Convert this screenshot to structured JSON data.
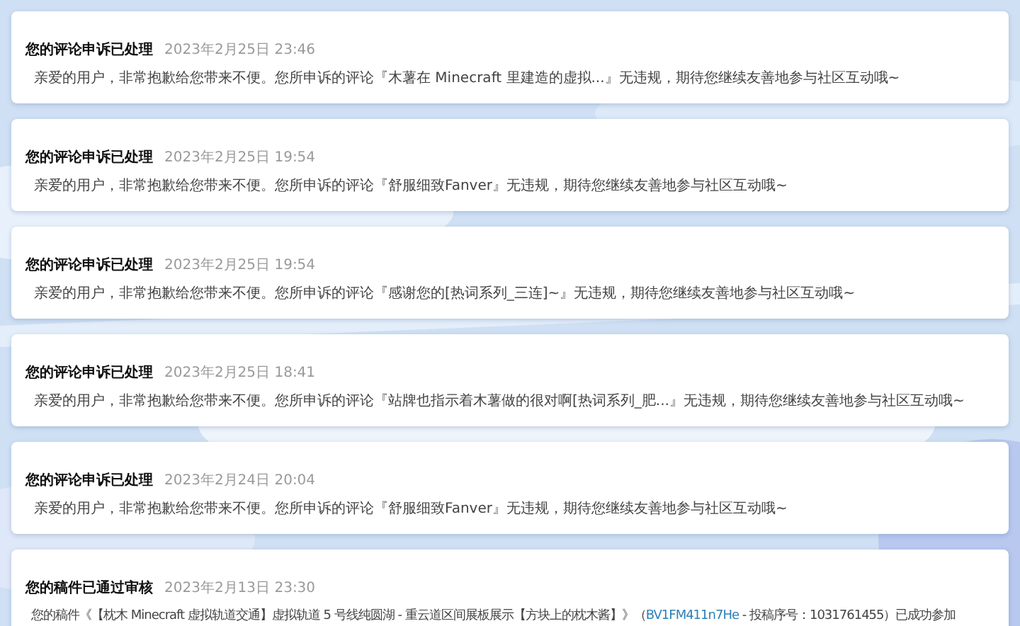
{
  "notifications": [
    {
      "title": "您的评论申诉已处理",
      "time": "2023年2月25日 23:46",
      "message": "亲爱的用户，非常抱歉给您带来不便。您所申诉的评论『木薯在 Minecraft 里建造的虚拟...』无违规，期待您继续友善地参与社区互动哦~"
    },
    {
      "title": "您的评论申诉已处理",
      "time": "2023年2月25日 19:54",
      "message": "亲爱的用户，非常抱歉给您带来不便。您所申诉的评论『舒服细致Fanver』无违规，期待您继续友善地参与社区互动哦~"
    },
    {
      "title": "您的评论申诉已处理",
      "time": "2023年2月25日 19:54",
      "message": "亲爱的用户，非常抱歉给您带来不便。您所申诉的评论『感谢您的[热词系列_三连]~』无违规，期待您继续友善地参与社区互动哦~"
    },
    {
      "title": "您的评论申诉已处理",
      "time": "2023年2月25日 18:41",
      "message": "亲爱的用户，非常抱歉给您带来不便。您所申诉的评论『站牌也指示着木薯做的很对啊[热词系列_肥...』无违规，期待您继续友善地参与社区互动哦~"
    },
    {
      "title": "您的评论申诉已处理",
      "time": "2023年2月24日 20:04",
      "message": "亲爱的用户，非常抱歉给您带来不便。您所申诉的评论『舒服细致Fanver』无违规，期待您继续友善地参与社区互动哦~"
    },
    {
      "title": "您的稿件已通过审核",
      "time": "2023年2月13日 23:30",
      "message": "您的稿件《【枕木 Minecraft 虚拟轨道交通】虚拟轨道 5 号线纯圆湖 - 重云道区间展板展示【方块上的枕木酱】》（",
      "link": "BV1FM411n7He",
      "message_end": "- 投稿序号：1031761455）已成功参加"
    }
  ]
}
